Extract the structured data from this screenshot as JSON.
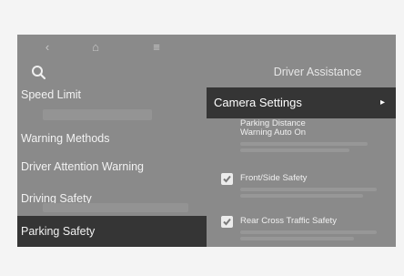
{
  "topbar": {
    "back_icon": "‹",
    "home_icon": "⌂",
    "menu_icon": "≡"
  },
  "search": {
    "icon": "search-icon"
  },
  "panel": {
    "title": "Driver Assistance"
  },
  "left_menu": [
    {
      "label": "Speed Limit"
    },
    {
      "label": "Warning Methods"
    },
    {
      "label": "Driver Attention Warning"
    },
    {
      "label": "Driving Safety"
    },
    {
      "label": "Parking Safety",
      "active": true
    }
  ],
  "right_menu": {
    "camera_settings": "Camera Settings",
    "camera_chevron": "▸",
    "parking_distance_line1": "Parking Distance",
    "parking_distance_line2": "Warning Auto On",
    "front_side_safety": "Front/Side Safety",
    "rear_cross_traffic_safety": "Rear Cross Traffic Safety"
  },
  "colors": {
    "screen_bg": "#8a8a8a",
    "highlight": "#353535",
    "text": "#f2f2f2"
  }
}
